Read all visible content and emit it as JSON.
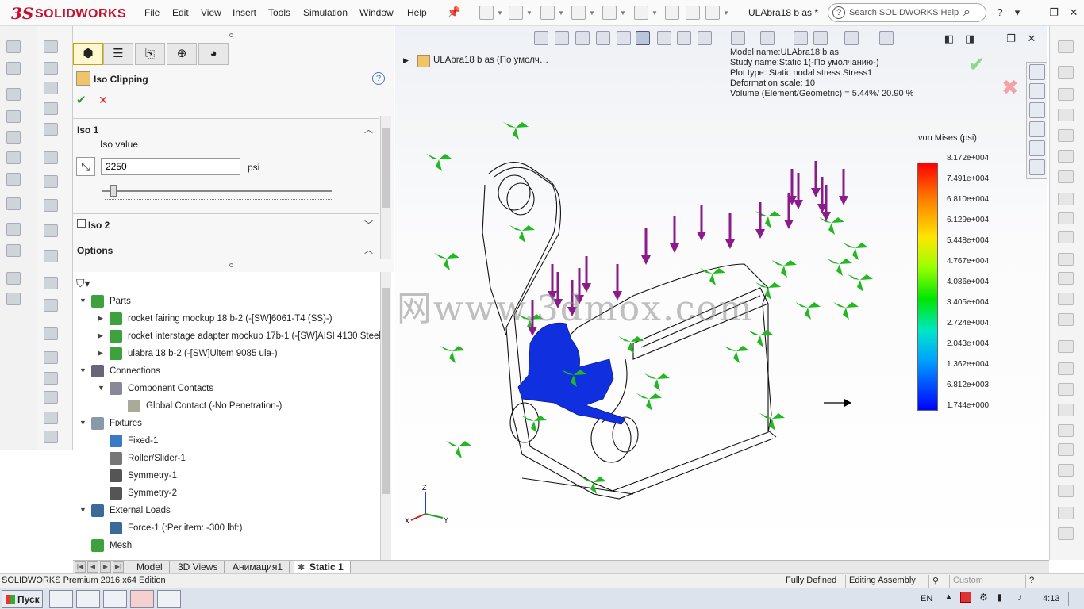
{
  "app": {
    "logo_text": "SOLIDWORKS",
    "document_title": "ULAbra18 b as *"
  },
  "menu": [
    "File",
    "Edit",
    "View",
    "Insert",
    "Tools",
    "Simulation",
    "Window",
    "Help"
  ],
  "search": {
    "placeholder": "Search SOLIDWORKS Help"
  },
  "property_manager": {
    "title": "Iso Clipping",
    "iso1_label": "Iso 1",
    "iso_value_label": "Iso value",
    "iso_value": "2250",
    "iso_unit": "psi",
    "slider_level_fraction": 0.05,
    "iso2_label": "Iso 2",
    "iso2_checked": false,
    "options_label": "Options"
  },
  "tree": {
    "rows": [
      {
        "label": "Parts",
        "indent": 0,
        "expanded": true,
        "icon": "parts-icon"
      },
      {
        "label": "rocket fairing mockup 18 b-2 (-[SW]6061-T4 (SS)-)",
        "indent": 1,
        "expanded": false,
        "icon": "part-icon"
      },
      {
        "label": "rocket interstage adapter mockup 17b-1 (-[SW]AISI 4130 Steel,",
        "indent": 1,
        "expanded": false,
        "icon": "part-icon"
      },
      {
        "label": "ulabra 18 b-2 (-[SW]Ultem 9085 ula-)",
        "indent": 1,
        "expanded": false,
        "icon": "part-icon"
      },
      {
        "label": "Connections",
        "indent": 0,
        "expanded": true,
        "icon": "connections-icon"
      },
      {
        "label": "Component Contacts",
        "indent": 1,
        "expanded": true,
        "icon": "component-contacts-icon"
      },
      {
        "label": "Global Contact (-No Penetration-)",
        "indent": 2,
        "expanded": null,
        "icon": "global-contact-icon"
      },
      {
        "label": "Fixtures",
        "indent": 0,
        "expanded": true,
        "icon": "fixtures-icon"
      },
      {
        "label": "Fixed-1",
        "indent": 1,
        "expanded": null,
        "icon": "fixed-icon"
      },
      {
        "label": "Roller/Slider-1",
        "indent": 1,
        "expanded": null,
        "icon": "roller-icon"
      },
      {
        "label": "Symmetry-1",
        "indent": 1,
        "expanded": null,
        "icon": "symmetry-icon"
      },
      {
        "label": "Symmetry-2",
        "indent": 1,
        "expanded": null,
        "icon": "symmetry-icon"
      },
      {
        "label": "External Loads",
        "indent": 0,
        "expanded": true,
        "icon": "external-loads-icon"
      },
      {
        "label": "Force-1 (:Per item: -300 lbf:)",
        "indent": 1,
        "expanded": null,
        "icon": "force-icon"
      },
      {
        "label": "Mesh",
        "indent": 0,
        "expanded": null,
        "icon": "mesh-icon"
      }
    ]
  },
  "viewport": {
    "tree_item": "ULAbra18 b as  (По умолч…",
    "info": [
      "Model name:ULAbra18 b as",
      "Study name:Static 1(-По умолчанию-)",
      "Plot type: Static nodal stress Stress1",
      "Deformation scale: 10",
      "Volume (Element/Geometric) = 5.44%/ 20.90 %"
    ],
    "legend_title": "von Mises (psi)",
    "legend_ticks": [
      "8.172e+004",
      "7.491e+004",
      "6.810e+004",
      "6.129e+004",
      "5.448e+004",
      "4.767e+004",
      "4.086e+004",
      "3.405e+004",
      "2.724e+004",
      "2.043e+004",
      "1.362e+004",
      "6.812e+003",
      "1.744e+000"
    ],
    "watermark": "莫西网www.3dmox.com",
    "triad": {
      "x": "X",
      "y": "Y",
      "z": "Z"
    }
  },
  "bottom_tabs": [
    "Model",
    "3D Views",
    "Анимация1",
    "Static 1"
  ],
  "status": {
    "edition": "SOLIDWORKS Premium 2016 x64 Edition",
    "defined": "Fully Defined",
    "mode": "Editing Assembly",
    "units": "Custom"
  },
  "taskbar": {
    "start_label": "Пуск",
    "language": "EN",
    "clock": "4:13"
  },
  "colors": {
    "brand": "#c8102e",
    "fixture_green": "#22b822",
    "load_purple": "#8b1a8b",
    "stress_blue": "#1030e0"
  }
}
